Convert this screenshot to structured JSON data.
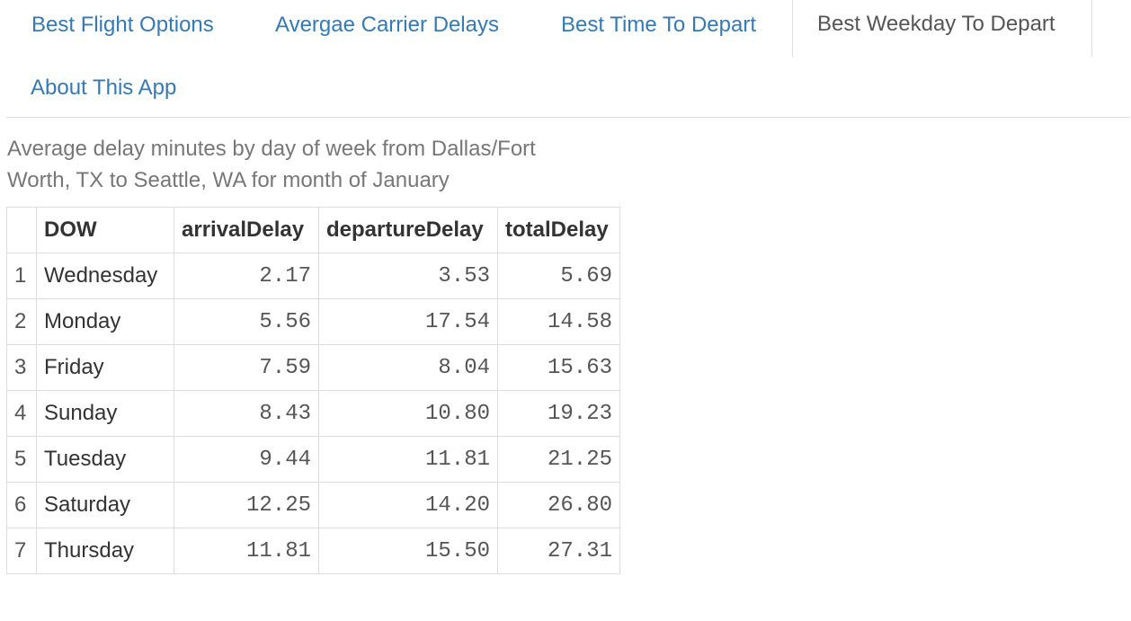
{
  "nav": {
    "tabs": [
      {
        "label": "Best Flight Options",
        "active": false
      },
      {
        "label": "Avergae Carrier Delays",
        "active": false
      },
      {
        "label": "Best Time To Depart",
        "active": false
      },
      {
        "label": "Best Weekday To Depart",
        "active": true
      },
      {
        "label": "About This App",
        "active": false
      }
    ]
  },
  "subtitle": "Average delay minutes by day of week from Dallas/Fort Worth, TX to Seattle, WA for month of January",
  "table": {
    "columns": [
      "",
      "DOW",
      "arrivalDelay",
      "departureDelay",
      "totalDelay"
    ],
    "rows": [
      [
        "1",
        "Wednesday",
        "2.17",
        "3.53",
        "5.69"
      ],
      [
        "2",
        "Monday",
        "5.56",
        "17.54",
        "14.58"
      ],
      [
        "3",
        "Friday",
        "7.59",
        "8.04",
        "15.63"
      ],
      [
        "4",
        "Sunday",
        "8.43",
        "10.80",
        "19.23"
      ],
      [
        "5",
        "Tuesday",
        "9.44",
        "11.81",
        "21.25"
      ],
      [
        "6",
        "Saturday",
        "12.25",
        "14.20",
        "26.80"
      ],
      [
        "7",
        "Thursday",
        "11.81",
        "15.50",
        "27.31"
      ]
    ]
  },
  "colors": {
    "link": "#337ab7",
    "active_tab_text": "#555555",
    "subtitle_text": "#777777",
    "border": "#dddddd"
  }
}
